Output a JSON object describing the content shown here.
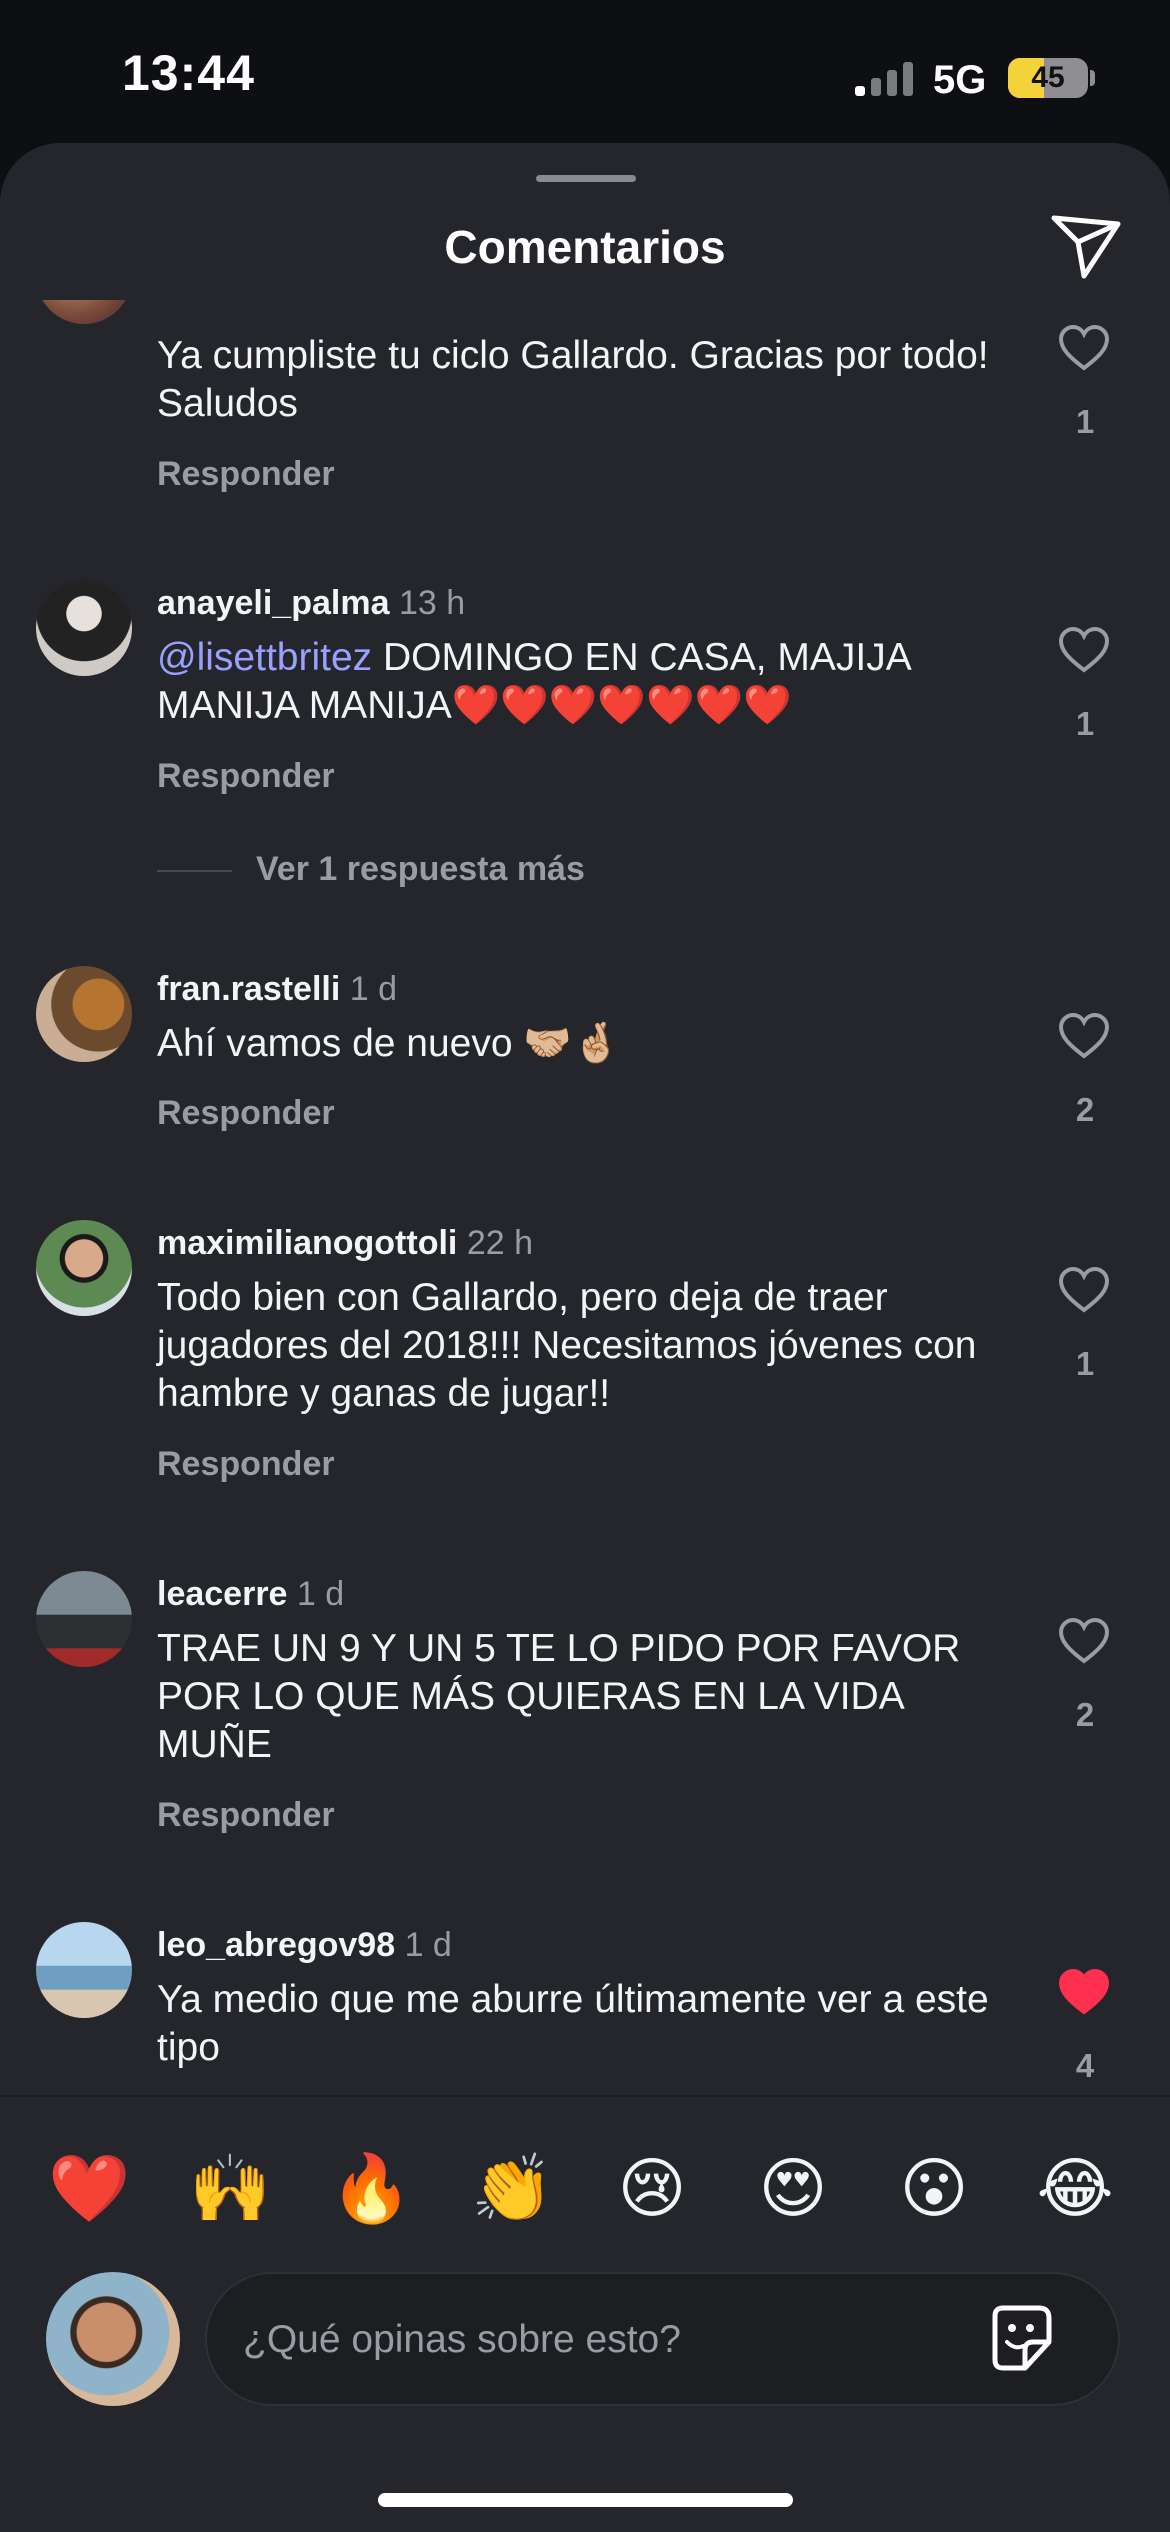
{
  "status_bar": {
    "time": "13:44",
    "network": "5G",
    "battery": "45",
    "battery_level_percent": 45
  },
  "header": {
    "title": "Comentarios",
    "send_icon": "paper-plane-icon"
  },
  "comments": [
    {
      "username": "",
      "time": "",
      "text": "Ya cumpliste tu ciclo Gallardo. Gracias por todo! Saludos",
      "reply_label": "Responder",
      "likes": "1",
      "liked": false
    },
    {
      "username": "anayeli_palma",
      "time": "13 h",
      "mention": "@lisettbritez",
      "text": " DOMINGO EN CASA, MAJIJA MANIJA MANIJA❤️❤️❤️❤️❤️❤️❤️",
      "reply_label": "Responder",
      "likes": "1",
      "liked": false,
      "more_replies": "Ver 1 respuesta más"
    },
    {
      "username": "fran.rastelli",
      "time": "1 d",
      "text": "Ahí vamos de nuevo 🤝🏼🤞🏼",
      "reply_label": "Responder",
      "likes": "2",
      "liked": false
    },
    {
      "username": "maximilianogottoli",
      "time": "22 h",
      "text": "Todo bien con Gallardo, pero deja de traer jugadores del 2018!!! Necesitamos jóvenes con hambre y ganas de jugar!!",
      "reply_label": "Responder",
      "likes": "1",
      "liked": false
    },
    {
      "username": "leacerre",
      "time": "1 d",
      "text": "TRAE UN 9 Y UN 5 TE LO PIDO POR FAVOR POR LO QUE MÁS QUIERAS EN LA VIDA MUÑE",
      "reply_label": "Responder",
      "likes": "2",
      "liked": false
    },
    {
      "username": "leo_abregov98",
      "time": "1 d",
      "text": "Ya medio que me aburre últimamente ver a este tipo",
      "likes": "4",
      "liked": true
    }
  ],
  "quick_reactions": [
    "❤️",
    "🙌",
    "🔥",
    "👏",
    "😢",
    "😍",
    "😮",
    "😂"
  ],
  "composer": {
    "placeholder": "¿Qué opinas sobre esto?",
    "sticker_icon": "sticker-icon"
  },
  "colors": {
    "sheet_bg": "#25262b",
    "muted_text": "#9a9ca3",
    "mention": "#9aa0ff",
    "liked_heart": "#ff2f4f"
  }
}
